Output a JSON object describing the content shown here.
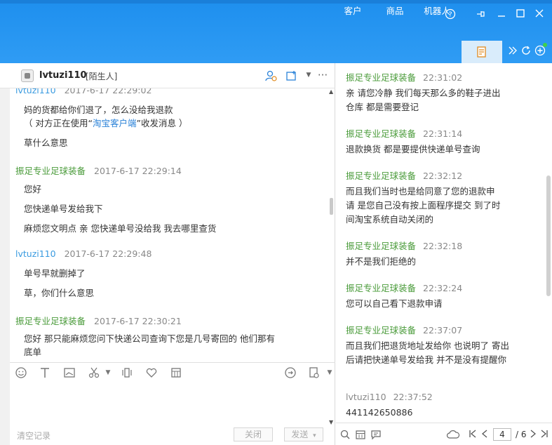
{
  "window": {
    "help": "?",
    "pin": "⊣",
    "minimize": "—",
    "maximize": "☐",
    "close": "✕"
  },
  "tabs": [
    {
      "label": "客户"
    },
    {
      "label": "商品"
    },
    {
      "label": "机器人"
    }
  ],
  "chat": {
    "contact_name": "lvtuzi110",
    "contact_tag": "[陌生人]",
    "messages": [
      {
        "sender": "lvtuzi110",
        "time": "2017-6-17 22:29:02",
        "lines": [
          "妈的货都给你们退了，怎么没给我退款"
        ]
      },
      {
        "notice_prefix": "（ 对方正在使用“",
        "notice_link": "淘宝客户端",
        "notice_suffix": "”收发消息 ）"
      },
      {
        "line": "草什么意思"
      },
      {
        "sender": "振足专业足球装备",
        "time": "2017-6-17 22:29:14",
        "lines": [
          "您好",
          "您快递单号发给我下",
          "麻烦您文明点 亲  您快递单号没给我 我去哪里查货"
        ]
      },
      {
        "sender": "lvtuzi110",
        "time": "2017-6-17 22:29:48",
        "lines": [
          "单号早就删掉了",
          "草，你们什么意思"
        ]
      },
      {
        "sender": "振足专业足球装备",
        "time": "2017-6-17 22:30:21",
        "lines": [
          "您好 那只能麻烦您问下快递公司查询下您是几号寄回的 他们那有",
          "底单"
        ]
      }
    ],
    "clear_record": "清空记录",
    "close_button": "关闭",
    "send_button": "发送",
    "send_dropdown": "▾"
  },
  "history": {
    "messages": [
      {
        "sender": "振足专业足球装备",
        "time": "22:31:02",
        "lines": [
          "亲  请您冷静 我们每天那么多的鞋子进出",
          "仓库  都是需要登记"
        ]
      },
      {
        "sender": "振足专业足球装备",
        "time": "22:31:14",
        "lines": [
          "退款换货 都是要提供快递单号查询"
        ]
      },
      {
        "sender": "振足专业足球装备",
        "time": "22:32:12",
        "lines": [
          "而且我们当时也是给同意了您的退款申",
          "请  是您自己没有按上面程序提交  到了时",
          "间淘宝系统自动关闭的"
        ]
      },
      {
        "sender": "振足专业足球装备",
        "time": "22:32:18",
        "lines": [
          "并不是我们拒绝的"
        ]
      },
      {
        "sender": "振足专业足球装备",
        "time": "22:32:24",
        "lines": [
          "您可以自己看下退款申请"
        ]
      },
      {
        "sender": "振足专业足球装备",
        "time": "22:37:07",
        "lines": [
          "而且我们把退货地址发给你 也说明了 寄出",
          "后请把快递单号发给我  并不是没有提醒你"
        ]
      },
      {
        "sender": "lvtuzi110",
        "time": "22:37:52",
        "lines": [
          "441142650886"
        ]
      }
    ],
    "page_current": "4",
    "page_total": "/ 6"
  }
}
